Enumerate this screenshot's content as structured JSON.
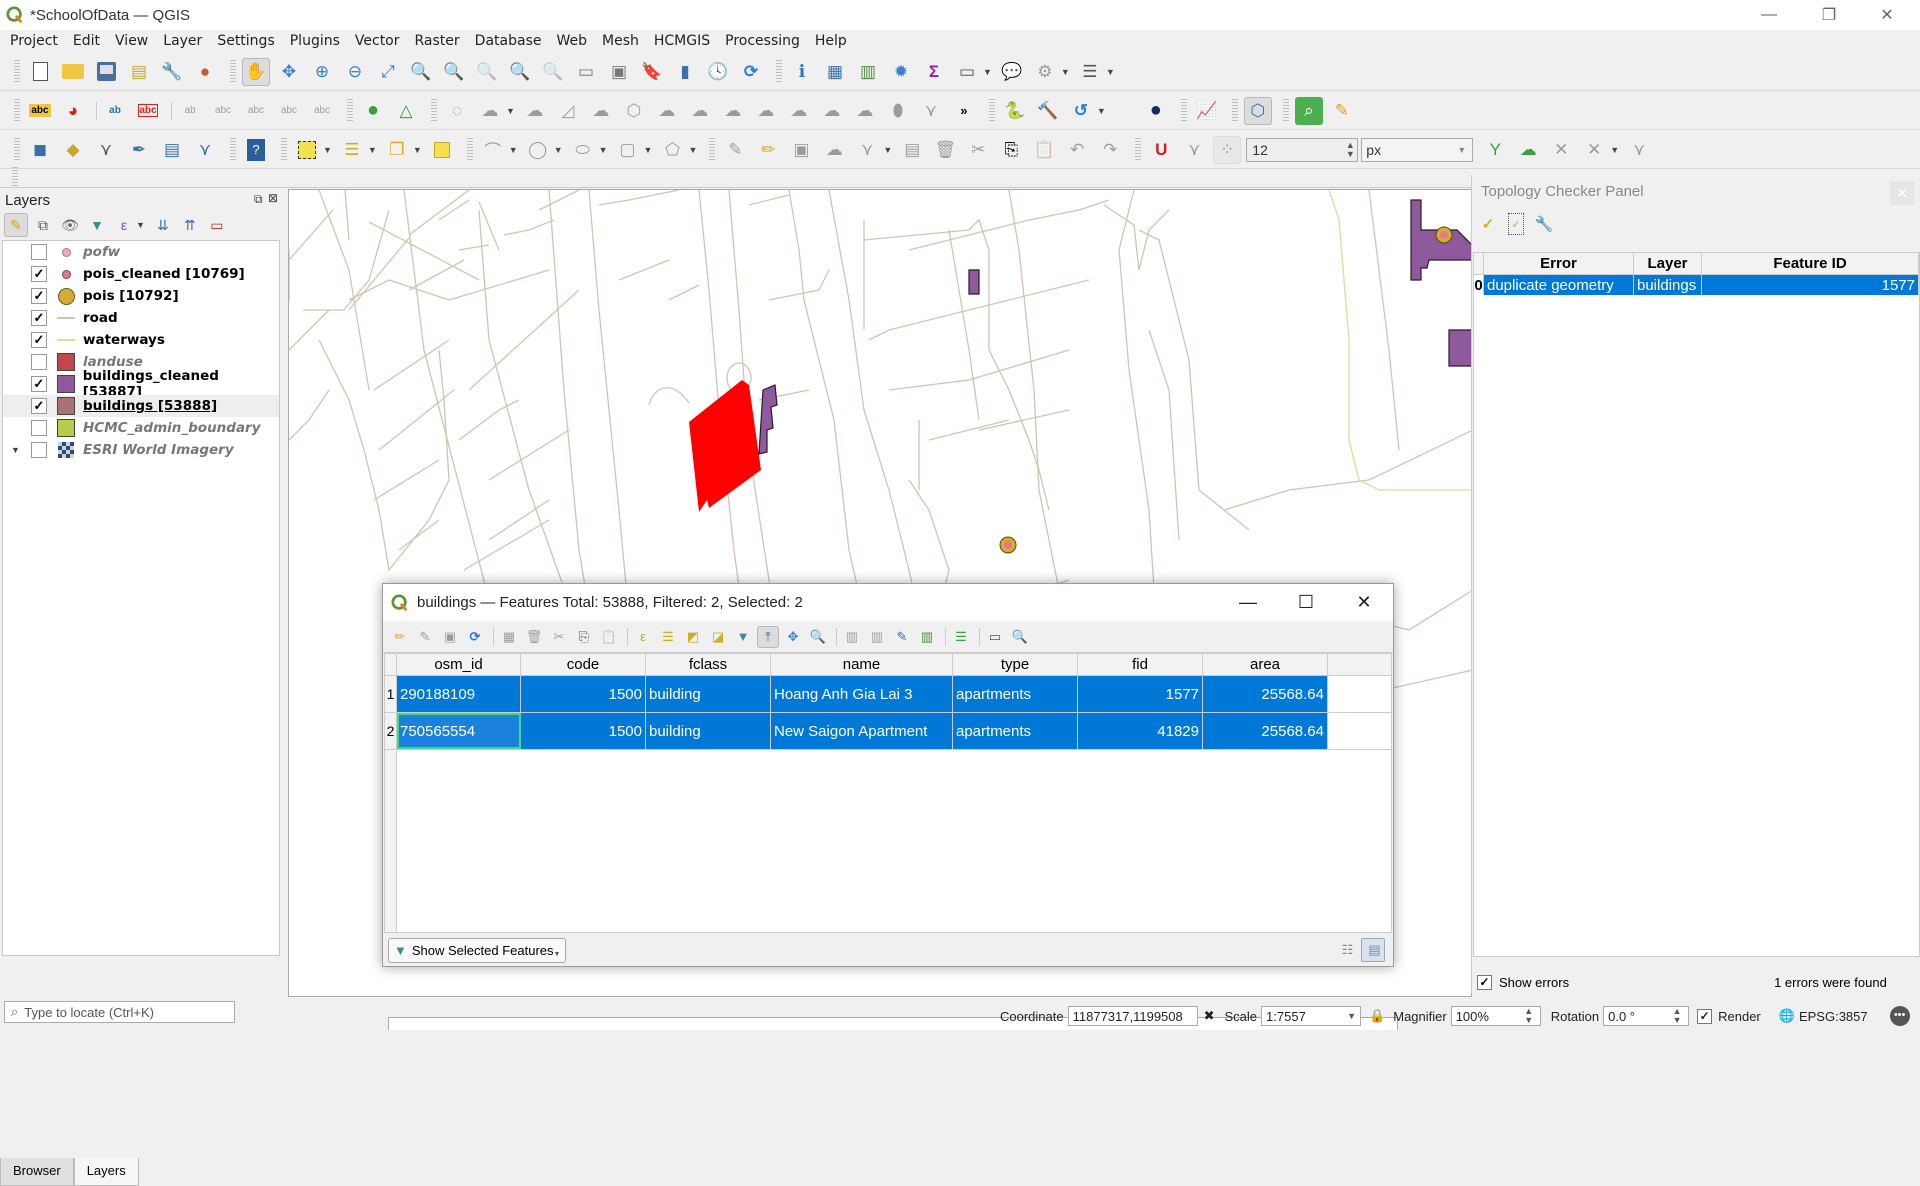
{
  "window": {
    "title": "*SchoolOfData — QGIS",
    "controls": {
      "minimize": "—",
      "restore": "❐",
      "close": "✕"
    }
  },
  "menubar": [
    "Project",
    "Edit",
    "View",
    "Layer",
    "Settings",
    "Plugins",
    "Vector",
    "Raster",
    "Database",
    "Web",
    "Mesh",
    "HCMGIS",
    "Processing",
    "Help"
  ],
  "toolbars": {
    "row1": [
      "new-project",
      "open-project",
      "save-project",
      "new-print-layout",
      "layout-manager",
      "style-manager",
      "pan-map",
      "pan-to-selection",
      "zoom-in",
      "zoom-out",
      "zoom-full",
      "zoom-to-selection",
      "zoom-to-layer",
      "zoom-native",
      "zoom-last",
      "zoom-next",
      "new-map-view",
      "new-3d-map-view",
      "new-spatial-bookmark",
      "show-bookmarks",
      "temporal-controller",
      "refresh",
      "identify-features",
      "open-attribute-table",
      "open-field-calculator",
      "processing-toolbox",
      "show-statistical-summary",
      "measure-line",
      "map-tips",
      "actions",
      "annotation"
    ],
    "row2": [
      "layer-labeling",
      "layer-diagram",
      "pin-labels",
      "highlight-pinned",
      "toggle-label-display",
      "move-label",
      "rotate-label",
      "change-label",
      "unknown-label",
      "georeferencer",
      "qgis-triangle",
      "add-ring",
      "add-part",
      "fill-ring",
      "delete-ring",
      "delete-part",
      "reshape",
      "offset-curve",
      "reverse-line",
      "simplify",
      "split-features",
      "split-parts",
      "merge-features",
      "merge-attributes",
      "rotate-point-symbols",
      "offset-point-symbols",
      "trim-extend",
      "more",
      "python-console",
      "plugin-reloader",
      "undo-redo",
      "globe",
      "profile-tool",
      "topology-checker",
      "quick-search",
      "hcmgis"
    ],
    "row3": {
      "snapping_tolerance": "12",
      "snapping_units": "px"
    }
  },
  "layers_panel": {
    "title": "Layers",
    "layers": [
      {
        "name": "pofw",
        "checked": false,
        "symbol": "point-pink-small",
        "color": "#f4a7b9"
      },
      {
        "name": "pois_cleaned [10769]",
        "checked": true,
        "symbol": "point-pink",
        "color": "#e8778a"
      },
      {
        "name": "pois [10792]",
        "checked": true,
        "symbol": "point-gold",
        "color": "#d4ac34"
      },
      {
        "name": "road",
        "checked": true,
        "symbol": "line",
        "color": "#cfc4b0"
      },
      {
        "name": "waterways",
        "checked": true,
        "symbol": "line",
        "color": "#cfe39a"
      },
      {
        "name": "landuse",
        "checked": false,
        "symbol": "fill",
        "color": "#c0474c"
      },
      {
        "name": "buildings_cleaned [53887]",
        "checked": true,
        "symbol": "fill",
        "color": "#8e5a9b"
      },
      {
        "name": "buildings [53888]",
        "checked": true,
        "symbol": "fill",
        "color": "#a87373",
        "selected": true
      },
      {
        "name": "HCMC_admin_boundary",
        "checked": false,
        "symbol": "fill",
        "color": "#b8cc4a"
      },
      {
        "name": "ESRI World Imagery",
        "checked": false,
        "symbol": "raster",
        "color": "#2f4a6b",
        "expandable": true
      }
    ],
    "tabs": [
      {
        "label": "Browser"
      },
      {
        "label": "Layers",
        "active": true
      }
    ],
    "locator_placeholder": "Type to locate (Ctrl+K)"
  },
  "topology_panel": {
    "title": "Topology Checker Panel",
    "columns": [
      "Error",
      "Layer",
      "Feature ID"
    ],
    "rows": [
      {
        "index": "0",
        "error": "duplicate geometry",
        "layer": "buildings",
        "feature_id": "1577"
      }
    ],
    "show_errors_label": "Show errors",
    "show_errors_checked": true,
    "status": "1 errors were found"
  },
  "attribute_table": {
    "title": "buildings — Features Total: 53888, Filtered: 2, Selected: 2",
    "columns": [
      "osm_id",
      "code",
      "fclass",
      "name",
      "type",
      "fid",
      "area"
    ],
    "rows": [
      {
        "n": "1",
        "osm_id": "290188109",
        "code": "1500",
        "fclass": "building",
        "name": "Hoang Anh Gia Lai 3",
        "type": "apartments",
        "fid": "1577",
        "area": "25568.64"
      },
      {
        "n": "2",
        "osm_id": "750565554",
        "code": "1500",
        "fclass": "building",
        "name": "New Saigon Apartment",
        "type": "apartments",
        "fid": "41829",
        "area": "25568.64"
      }
    ],
    "filter_button": "Show Selected Features",
    "selection_color": "#0078d7"
  },
  "statusbar": {
    "coordinate_label": "Coordinate",
    "coordinate": "11877317,1199508",
    "scale_label": "Scale",
    "scale": "1:7557",
    "magnifier_label": "Magnifier",
    "magnifier": "100%",
    "rotation_label": "Rotation",
    "rotation": "0.0 °",
    "render_label": "Render",
    "render_checked": true,
    "crs": "EPSG:3857"
  },
  "map": {
    "highlight_color": "#ff0000",
    "building_color": "#8e5a9b",
    "road_color": "#cfc4b0",
    "waterway_color": "#cfe39a"
  }
}
